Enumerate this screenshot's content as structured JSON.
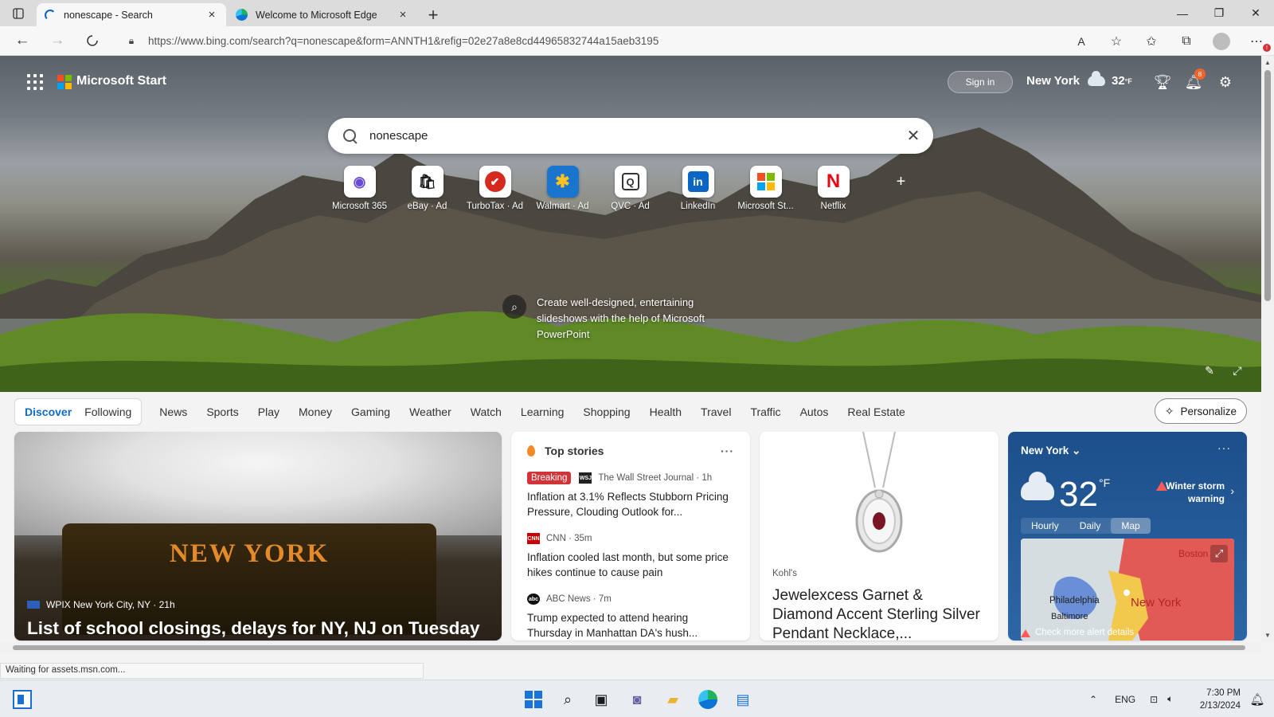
{
  "browser": {
    "tabs": [
      {
        "title": "nonescape - Search",
        "active": true,
        "loading": true
      },
      {
        "title": "Welcome to Microsoft Edge",
        "active": false,
        "loading": false
      }
    ],
    "url": "https://www.bing.com/search?q=nonescape&form=ANNTH1&refig=02e27a8e8cd44965832744a15aeb3195",
    "status": "Waiting for assets.msn.com...",
    "read_aloud_label": "A"
  },
  "header": {
    "brand": "Microsoft Start",
    "sign_in": "Sign in",
    "location": "New York",
    "temp": "32",
    "unit": "°F",
    "notifications_count": "8"
  },
  "search": {
    "query": "nonescape"
  },
  "quicklinks": [
    {
      "label": "Microsoft 365",
      "glyph": "◉",
      "color": "#6b4bd6"
    },
    {
      "label": "eBay · Ad",
      "glyph": "🛍",
      "color": "#1a1a1a"
    },
    {
      "label": "TurboTax · Ad",
      "glyph": "✔",
      "color": "#d52b1e"
    },
    {
      "label": "Walmart · Ad",
      "glyph": "✱",
      "color": "#1a75cf"
    },
    {
      "label": "QVC · Ad",
      "glyph": "Q",
      "color": "#333333"
    },
    {
      "label": "LinkedIn",
      "glyph": "in",
      "color": "#0a66c2"
    },
    {
      "label": "Microsoft St...",
      "glyph": "⊞",
      "color": "#f25022"
    },
    {
      "label": "Netflix",
      "glyph": "N",
      "color": "#e50914"
    }
  ],
  "promo": {
    "text": "Create well-designed, entertaining slideshows with the help of Microsoft PowerPoint"
  },
  "feed_nav": {
    "pills": [
      "Discover",
      "Following"
    ],
    "items": [
      "News",
      "Sports",
      "Play",
      "Money",
      "Gaming",
      "Weather",
      "Watch",
      "Learning",
      "Shopping",
      "Health",
      "Travel",
      "Traffic",
      "Autos",
      "Real Estate"
    ],
    "personalize": "Personalize"
  },
  "hero_card": {
    "plate_text": "NEW YORK",
    "source": "WPIX New York City, NY · 21h",
    "title": "List of school closings, delays for NY, NJ on Tuesday"
  },
  "top_stories": {
    "heading": "Top stories",
    "stories": [
      {
        "badge": "Breaking",
        "source": "The Wall Street Journal · 1h",
        "logo_text": "WSJ",
        "logo_color": "#222222",
        "title": "Inflation at 3.1% Reflects Stubborn Pricing Pressure, Clouding Outlook for..."
      },
      {
        "badge": "",
        "source": "CNN · 35m",
        "logo_text": "CNN",
        "logo_color": "#cc0000",
        "title": "Inflation cooled last month, but some price hikes continue to cause pain"
      },
      {
        "badge": "",
        "source": "ABC News · 7m",
        "logo_text": "abc",
        "logo_color": "#111111",
        "title": "Trump expected to attend hearing Thursday in Manhattan DA's hush..."
      }
    ]
  },
  "product_card": {
    "brand": "Kohl's",
    "title": "Jewelexcess Garnet & Diamond Accent Sterling Silver Pendant Necklace,..."
  },
  "weather_card": {
    "location": "New York",
    "temp": "32",
    "unit": "°F",
    "alert": "Winter storm warning",
    "tabs": [
      "Hourly",
      "Daily",
      "Map"
    ],
    "active_tab": "Map",
    "map_labels": [
      "Boston",
      "Philadelphia",
      "Baltimore",
      "New York"
    ],
    "check_alert": "Check more alert details"
  },
  "taskbar": {
    "language": "ENG",
    "time": "7:30 PM",
    "date": "2/13/2024"
  }
}
